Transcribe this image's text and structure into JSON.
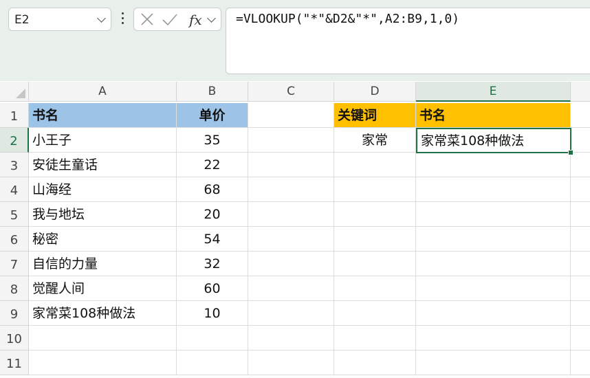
{
  "name_box": "E2",
  "formula_bar": {
    "fx_label": "fx",
    "formula": "=VLOOKUP(\"*\"&D2&\"*\",A2:B9,1,0)"
  },
  "columns": [
    "A",
    "B",
    "C",
    "D",
    "E"
  ],
  "rows": [
    "1",
    "2",
    "3",
    "4",
    "5",
    "6",
    "7",
    "8",
    "9",
    "10",
    "11"
  ],
  "table": {
    "header": {
      "name": "书名",
      "price": "单价"
    },
    "items": [
      {
        "name": "小王子",
        "price": "35"
      },
      {
        "name": "安徒生童话",
        "price": "22"
      },
      {
        "name": "山海经",
        "price": "68"
      },
      {
        "name": "我与地坛",
        "price": "20"
      },
      {
        "name": "秘密",
        "price": "54"
      },
      {
        "name": "自信的力量",
        "price": "32"
      },
      {
        "name": "觉醒人间",
        "price": "60"
      },
      {
        "name": "家常菜108种做法",
        "price": "10"
      }
    ]
  },
  "lookup": {
    "keyword_header": "关键词",
    "result_header": "书名",
    "keyword": "家常",
    "result": "家常菜108种做法"
  },
  "colors": {
    "header_blue": "#9dc3e6",
    "header_gold": "#ffc000",
    "selection_green": "#1e7145"
  }
}
